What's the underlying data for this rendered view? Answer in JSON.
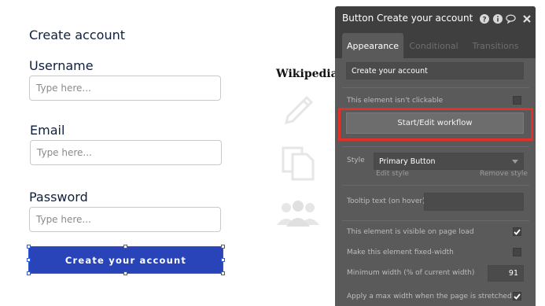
{
  "form": {
    "title": "Create account",
    "username_label": "Username",
    "username_placeholder": "Type here...",
    "email_label": "Email",
    "email_placeholder": "Type here...",
    "password_label": "Password",
    "password_placeholder": "Type here...",
    "submit_label": "Create your account"
  },
  "background": {
    "wikipedia_label": "Wikipedia",
    "icons": [
      "pencil-icon",
      "copy-document-icon",
      "users-group-icon"
    ]
  },
  "panel": {
    "title": "Button Create your account",
    "header_icons": [
      "help-icon",
      "info-icon",
      "comment-icon",
      "close-icon"
    ],
    "tabs": [
      {
        "label": "Appearance",
        "active": true
      },
      {
        "label": "Conditional",
        "active": false
      },
      {
        "label": "Transitions",
        "active": false
      }
    ],
    "button_text_value": "Create your account",
    "not_clickable_label": "This element isn't clickable",
    "not_clickable_checked": false,
    "workflow_button_label": "Start/Edit workflow",
    "style_label": "Style",
    "style_value": "Primary Button",
    "edit_style_label": "Edit style",
    "remove_style_label": "Remove style",
    "tooltip_label": "Tooltip text (on hover)",
    "tooltip_value": "",
    "visible_on_load_label": "This element is visible on page load",
    "visible_on_load_checked": true,
    "fixed_width_label": "Make this element fixed-width",
    "fixed_width_checked": false,
    "min_width_label": "Minimum width (% of current width)",
    "min_width_value": "91",
    "max_width_label": "Apply a max width when the page is stretched",
    "max_width_checked": true
  },
  "colors": {
    "primary_button": "#2944b8",
    "selection": "#2a5bd7",
    "panel_bg": "#5a5a5a",
    "panel_header": "#3f3f3f",
    "highlight": "#e0312a"
  }
}
